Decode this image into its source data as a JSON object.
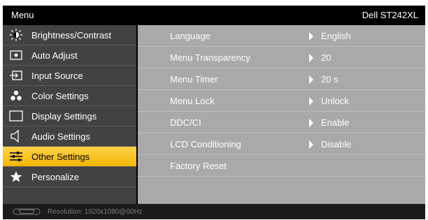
{
  "header": {
    "title": "Menu",
    "model": "Dell ST242XL"
  },
  "sidebar": {
    "items": [
      {
        "label": "Brightness/Contrast",
        "icon": "brightness-icon",
        "selected": false
      },
      {
        "label": "Auto Adjust",
        "icon": "auto-adjust-icon",
        "selected": false
      },
      {
        "label": "Input Source",
        "icon": "input-source-icon",
        "selected": false
      },
      {
        "label": "Color Settings",
        "icon": "color-settings-icon",
        "selected": false
      },
      {
        "label": "Display Settings",
        "icon": "display-settings-icon",
        "selected": false
      },
      {
        "label": "Audio Settings",
        "icon": "speaker-icon",
        "selected": false
      },
      {
        "label": "Other Settings",
        "icon": "other-settings-icon",
        "selected": true
      },
      {
        "label": "Personalize",
        "icon": "star-icon",
        "selected": false
      }
    ]
  },
  "settings": {
    "rows": [
      {
        "name": "Language",
        "value": "English"
      },
      {
        "name": "Menu Transparency",
        "value": "20"
      },
      {
        "name": "Menu Timer",
        "value": "20 s"
      },
      {
        "name": "Menu Lock",
        "value": "Unlock"
      },
      {
        "name": "DDC/CI",
        "value": "Enable"
      },
      {
        "name": "LCD Conditioning",
        "value": "Disable"
      },
      {
        "name": "Factory Reset",
        "value": ""
      }
    ]
  },
  "footer": {
    "resolution": "Resolution:  1920x1080@60Hz",
    "icon": "vga-connector-icon"
  },
  "colors": {
    "selected": "#f2b704",
    "sidebar": "#424242",
    "content": "#a9a9a9",
    "background": "#000000"
  }
}
